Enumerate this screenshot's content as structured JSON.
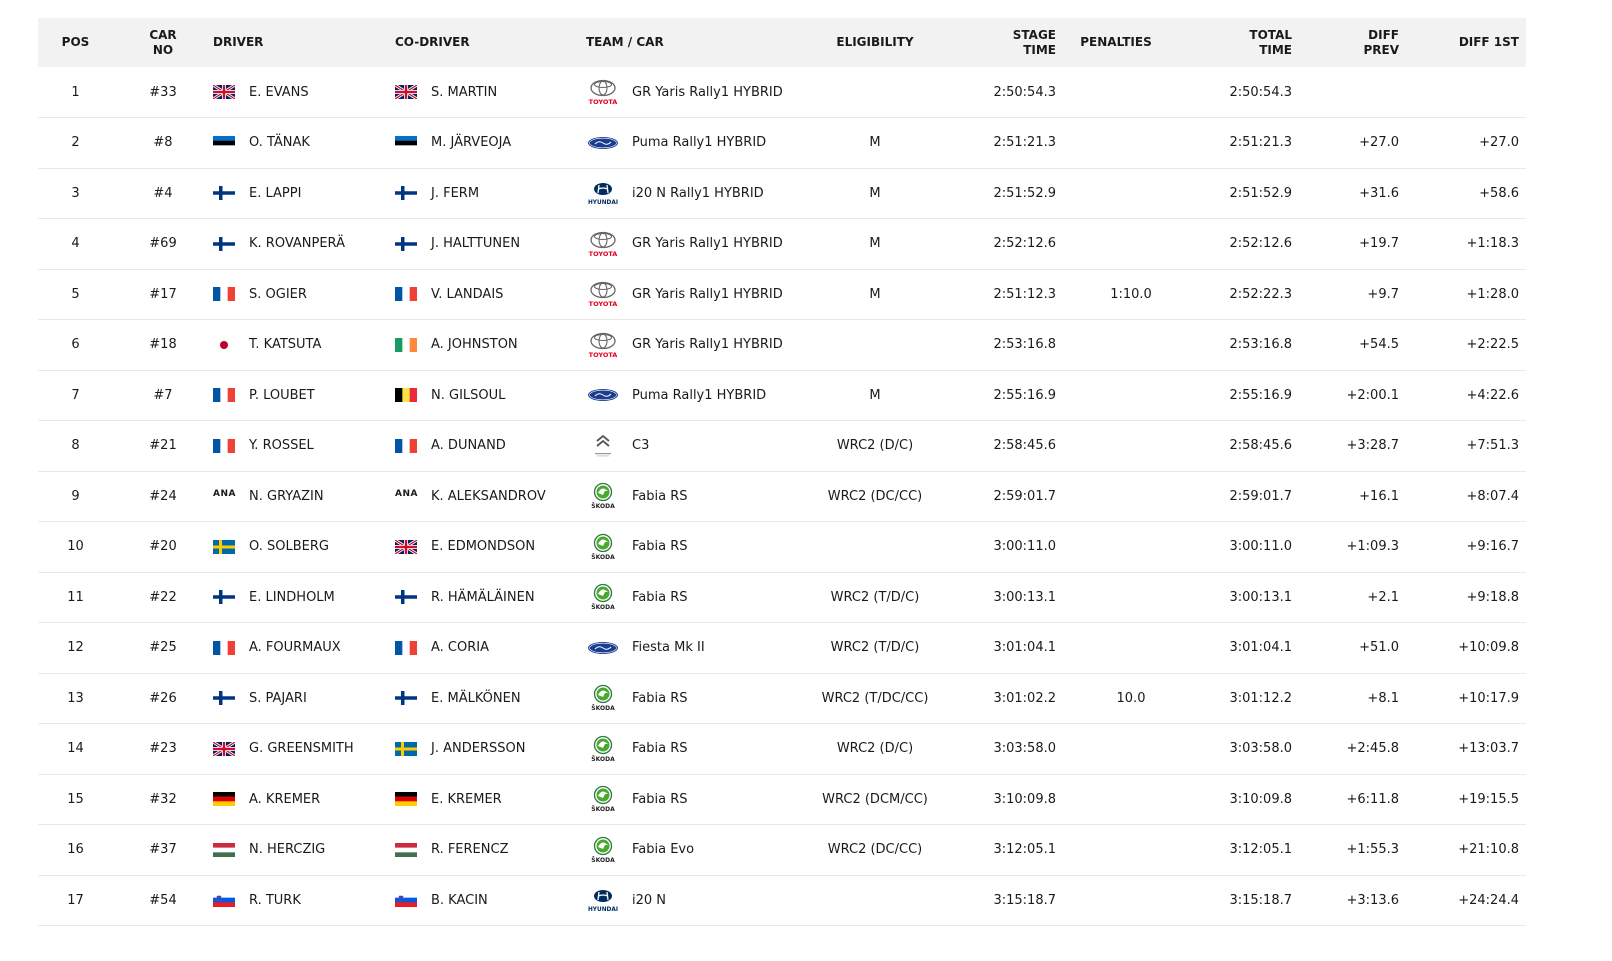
{
  "headers": {
    "pos": "POS",
    "car_no": "CAR NO",
    "driver": "DRIVER",
    "co_driver": "CO-DRIVER",
    "team_car": "TEAM / CAR",
    "eligibility": "ELIGIBILITY",
    "stage_time": "STAGE TIME",
    "penalties": "PENALTIES",
    "total_time": "TOTAL TIME",
    "diff_prev": "DIFF PREV",
    "diff_1st": "DIFF 1ST"
  },
  "brand_labels": {
    "toyota": "TOYOTA",
    "hyundai": "HYUNDAI",
    "skoda": "ŠKODA"
  },
  "rows": [
    {
      "pos": "1",
      "car_no": "#33",
      "driver": "E. EVANS",
      "driver_flag": "gb",
      "co_driver": "S. MARTIN",
      "co_flag": "gb",
      "brand": "toyota",
      "car": "GR Yaris Rally1 HYBRID",
      "eligibility": "",
      "stage_time": "2:50:54.3",
      "penalties": "",
      "total_time": "2:50:54.3",
      "diff_prev": "",
      "diff_1st": ""
    },
    {
      "pos": "2",
      "car_no": "#8",
      "driver": "O. TÄNAK",
      "driver_flag": "ee",
      "co_driver": "M. JÄRVEOJA",
      "co_flag": "ee",
      "brand": "ford",
      "car": "Puma Rally1 HYBRID",
      "eligibility": "M",
      "stage_time": "2:51:21.3",
      "penalties": "",
      "total_time": "2:51:21.3",
      "diff_prev": "+27.0",
      "diff_1st": "+27.0"
    },
    {
      "pos": "3",
      "car_no": "#4",
      "driver": "E. LAPPI",
      "driver_flag": "fi",
      "co_driver": "J. FERM",
      "co_flag": "fi",
      "brand": "hyundai",
      "car": "i20 N Rally1 HYBRID",
      "eligibility": "M",
      "stage_time": "2:51:52.9",
      "penalties": "",
      "total_time": "2:51:52.9",
      "diff_prev": "+31.6",
      "diff_1st": "+58.6"
    },
    {
      "pos": "4",
      "car_no": "#69",
      "driver": "K. ROVANPERÄ",
      "driver_flag": "fi",
      "co_driver": "J. HALTTUNEN",
      "co_flag": "fi",
      "brand": "toyota",
      "car": "GR Yaris Rally1 HYBRID",
      "eligibility": "M",
      "stage_time": "2:52:12.6",
      "penalties": "",
      "total_time": "2:52:12.6",
      "diff_prev": "+19.7",
      "diff_1st": "+1:18.3"
    },
    {
      "pos": "5",
      "car_no": "#17",
      "driver": "S. OGIER",
      "driver_flag": "fr",
      "co_driver": "V. LANDAIS",
      "co_flag": "fr",
      "brand": "toyota",
      "car": "GR Yaris Rally1 HYBRID",
      "eligibility": "M",
      "stage_time": "2:51:12.3",
      "penalties": "1:10.0",
      "total_time": "2:52:22.3",
      "diff_prev": "+9.7",
      "diff_1st": "+1:28.0"
    },
    {
      "pos": "6",
      "car_no": "#18",
      "driver": "T. KATSUTA",
      "driver_flag": "jp",
      "co_driver": "A. JOHNSTON",
      "co_flag": "ie",
      "brand": "toyota",
      "car": "GR Yaris Rally1 HYBRID",
      "eligibility": "",
      "stage_time": "2:53:16.8",
      "penalties": "",
      "total_time": "2:53:16.8",
      "diff_prev": "+54.5",
      "diff_1st": "+2:22.5"
    },
    {
      "pos": "7",
      "car_no": "#7",
      "driver": "P. LOUBET",
      "driver_flag": "fr",
      "co_driver": "N. GILSOUL",
      "co_flag": "be",
      "brand": "ford",
      "car": "Puma Rally1 HYBRID",
      "eligibility": "M",
      "stage_time": "2:55:16.9",
      "penalties": "",
      "total_time": "2:55:16.9",
      "diff_prev": "+2:00.1",
      "diff_1st": "+4:22.6"
    },
    {
      "pos": "8",
      "car_no": "#21",
      "driver": "Y. ROSSEL",
      "driver_flag": "fr",
      "co_driver": "A. DUNAND",
      "co_flag": "fr",
      "brand": "citroen",
      "car": "C3",
      "eligibility": "WRC2 (D/C)",
      "stage_time": "2:58:45.6",
      "penalties": "",
      "total_time": "2:58:45.6",
      "diff_prev": "+3:28.7",
      "diff_1st": "+7:51.3"
    },
    {
      "pos": "9",
      "car_no": "#24",
      "driver": "N. GRYAZIN",
      "driver_flag": "ana",
      "co_driver": "K. ALEKSANDROV",
      "co_flag": "ana",
      "brand": "skoda",
      "car": "Fabia RS",
      "eligibility": "WRC2 (DC/CC)",
      "stage_time": "2:59:01.7",
      "penalties": "",
      "total_time": "2:59:01.7",
      "diff_prev": "+16.1",
      "diff_1st": "+8:07.4"
    },
    {
      "pos": "10",
      "car_no": "#20",
      "driver": "O. SOLBERG",
      "driver_flag": "se",
      "co_driver": "E. EDMONDSON",
      "co_flag": "gb",
      "brand": "skoda",
      "car": "Fabia RS",
      "eligibility": "",
      "stage_time": "3:00:11.0",
      "penalties": "",
      "total_time": "3:00:11.0",
      "diff_prev": "+1:09.3",
      "diff_1st": "+9:16.7"
    },
    {
      "pos": "11",
      "car_no": "#22",
      "driver": "E. LINDHOLM",
      "driver_flag": "fi",
      "co_driver": "R. HÄMÄLÄINEN",
      "co_flag": "fi",
      "brand": "skoda",
      "car": "Fabia RS",
      "eligibility": "WRC2 (T/D/C)",
      "stage_time": "3:00:13.1",
      "penalties": "",
      "total_time": "3:00:13.1",
      "diff_prev": "+2.1",
      "diff_1st": "+9:18.8"
    },
    {
      "pos": "12",
      "car_no": "#25",
      "driver": "A. FOURMAUX",
      "driver_flag": "fr",
      "co_driver": "A. CORIA",
      "co_flag": "fr",
      "brand": "ford",
      "car": "Fiesta Mk II",
      "eligibility": "WRC2 (T/D/C)",
      "stage_time": "3:01:04.1",
      "penalties": "",
      "total_time": "3:01:04.1",
      "diff_prev": "+51.0",
      "diff_1st": "+10:09.8"
    },
    {
      "pos": "13",
      "car_no": "#26",
      "driver": "S. PAJARI",
      "driver_flag": "fi",
      "co_driver": "E. MÄLKÖNEN",
      "co_flag": "fi",
      "brand": "skoda",
      "car": "Fabia RS",
      "eligibility": "WRC2 (T/DC/CC)",
      "stage_time": "3:01:02.2",
      "penalties": "10.0",
      "total_time": "3:01:12.2",
      "diff_prev": "+8.1",
      "diff_1st": "+10:17.9"
    },
    {
      "pos": "14",
      "car_no": "#23",
      "driver": "G. GREENSMITH",
      "driver_flag": "gb",
      "co_driver": "J. ANDERSSON",
      "co_flag": "se",
      "brand": "skoda",
      "car": "Fabia RS",
      "eligibility": "WRC2 (D/C)",
      "stage_time": "3:03:58.0",
      "penalties": "",
      "total_time": "3:03:58.0",
      "diff_prev": "+2:45.8",
      "diff_1st": "+13:03.7"
    },
    {
      "pos": "15",
      "car_no": "#32",
      "driver": "A. KREMER",
      "driver_flag": "de",
      "co_driver": "E. KREMER",
      "co_flag": "de",
      "brand": "skoda",
      "car": "Fabia RS",
      "eligibility": "WRC2 (DCM/CC)",
      "stage_time": "3:10:09.8",
      "penalties": "",
      "total_time": "3:10:09.8",
      "diff_prev": "+6:11.8",
      "diff_1st": "+19:15.5"
    },
    {
      "pos": "16",
      "car_no": "#37",
      "driver": "N. HERCZIG",
      "driver_flag": "hu",
      "co_driver": "R. FERENCZ",
      "co_flag": "hu",
      "brand": "skoda",
      "car": "Fabia Evo",
      "eligibility": "WRC2 (DC/CC)",
      "stage_time": "3:12:05.1",
      "penalties": "",
      "total_time": "3:12:05.1",
      "diff_prev": "+1:55.3",
      "diff_1st": "+21:10.8"
    },
    {
      "pos": "17",
      "car_no": "#54",
      "driver": "R. TURK",
      "driver_flag": "si",
      "co_driver": "B. KACIN",
      "co_flag": "si",
      "brand": "hyundai",
      "car": "i20 N",
      "eligibility": "",
      "stage_time": "3:15:18.7",
      "penalties": "",
      "total_time": "3:15:18.7",
      "diff_prev": "+3:13.6",
      "diff_1st": "+24:24.4"
    }
  ]
}
